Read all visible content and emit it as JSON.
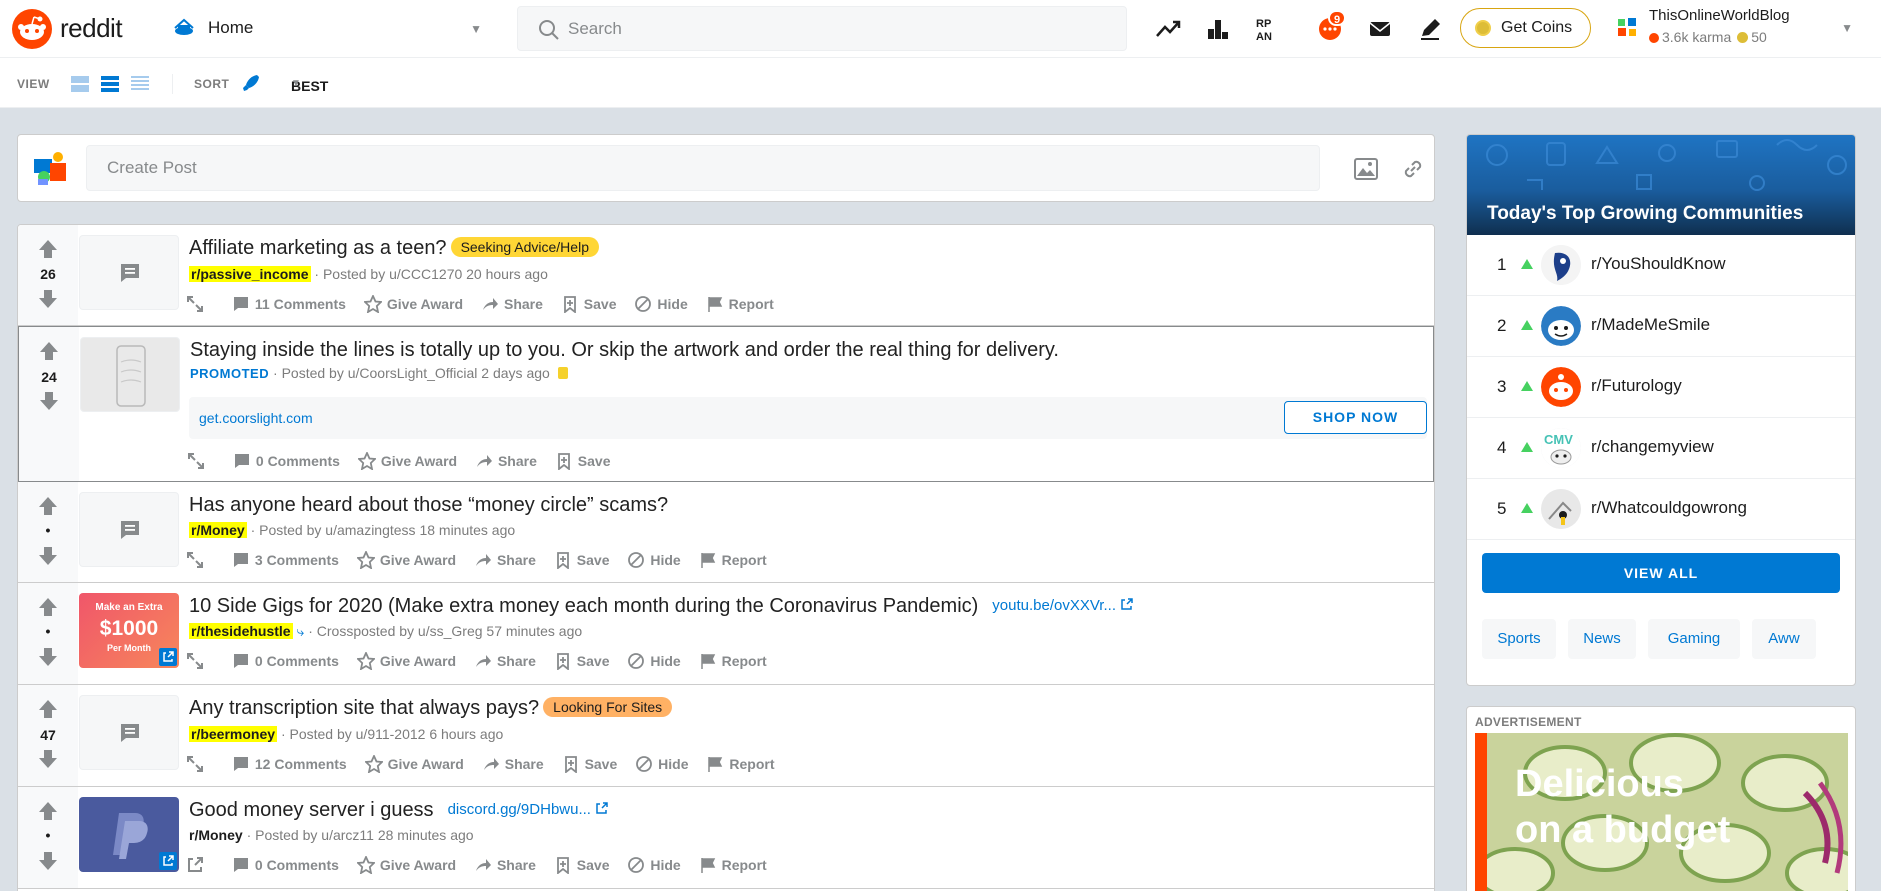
{
  "header": {
    "logo_text": "reddit",
    "home_label": "Home",
    "search_placeholder": "Search",
    "chat_badge": "9",
    "coins_button": "Get Coins",
    "user": {
      "name": "ThisOnlineWorldBlog",
      "karma": "3.6k karma",
      "coins": "50"
    }
  },
  "subbar": {
    "view_label": "VIEW",
    "sort_label": "SORT",
    "sort_value": "BEST"
  },
  "create_post": {
    "placeholder": "Create Post"
  },
  "posts": [
    {
      "score": "26",
      "title": "Affiliate marketing as a teen?",
      "flair": "Seeking Advice/Help",
      "subreddit": "r/passive_income",
      "posted": "· Posted by u/CCC1270 20 hours ago",
      "comments": "11 Comments",
      "award": "Give Award",
      "share": "Share",
      "save": "Save",
      "hide": "Hide",
      "report": "Report"
    },
    {
      "score": "24",
      "title": "Staying inside the lines is totally up to you. Or skip the artwork and order the real thing for delivery.",
      "promoted": "PROMOTED",
      "posted": "· Posted by u/CoorsLight_Official 2 days ago",
      "promo_url": "get.coorslight.com",
      "cta": "SHOP NOW",
      "comments": "0 Comments",
      "award": "Give Award",
      "share": "Share",
      "save": "Save"
    },
    {
      "score": "•",
      "title": "Has anyone heard about those “money circle” scams?",
      "subreddit": "r/Money",
      "posted": "· Posted by u/amazingtess 18 minutes ago",
      "comments": "3 Comments",
      "award": "Give Award",
      "share": "Share",
      "save": "Save",
      "hide": "Hide",
      "report": "Report"
    },
    {
      "score": "•",
      "title": "10 Side Gigs for 2020 (Make extra money each month during the Coronavirus Pandemic)",
      "link": "youtu.be/ovXXVr...",
      "subreddit": "r/thesidehustle",
      "posted": "· Crossposted by u/ss_Greg 57 minutes ago",
      "thumb_lines": [
        "Make an Extra",
        "$1000",
        "Per Month"
      ],
      "comments": "0 Comments",
      "award": "Give Award",
      "share": "Share",
      "save": "Save",
      "hide": "Hide",
      "report": "Report"
    },
    {
      "score": "47",
      "title": "Any transcription site that always pays?",
      "flair": "Looking For Sites",
      "subreddit": "r/beermoney",
      "posted": "· Posted by u/911-2012 6 hours ago",
      "comments": "12 Comments",
      "award": "Give Award",
      "share": "Share",
      "save": "Save",
      "hide": "Hide",
      "report": "Report"
    },
    {
      "score": "•",
      "title": "Good money server i guess",
      "link": "discord.gg/9DHbwu...",
      "subreddit": "r/Money",
      "posted": "· Posted by u/arcz11 28 minutes ago",
      "comments": "0 Comments",
      "award": "Give Award",
      "share": "Share",
      "save": "Save",
      "hide": "Hide",
      "report": "Report"
    }
  ],
  "sidebar": {
    "title": "Today's Top Growing Communities",
    "communities": [
      {
        "rank": "1",
        "name": "r/YouShouldKnow"
      },
      {
        "rank": "2",
        "name": "r/MadeMeSmile"
      },
      {
        "rank": "3",
        "name": "r/Futurology"
      },
      {
        "rank": "4",
        "name": "r/changemyview"
      },
      {
        "rank": "5",
        "name": "r/Whatcouldgowrong"
      }
    ],
    "view_all": "VIEW ALL",
    "topics": [
      "Sports",
      "News",
      "Gaming",
      "Aww"
    ]
  },
  "ad": {
    "label": "ADVERTISEMENT",
    "headline_1": "Delicious",
    "headline_2": "on a budget"
  },
  "colors": {
    "brand": "#ff4500",
    "link": "#0079d3",
    "upvote_green": "#46d160",
    "highlight": "#ffff00"
  }
}
